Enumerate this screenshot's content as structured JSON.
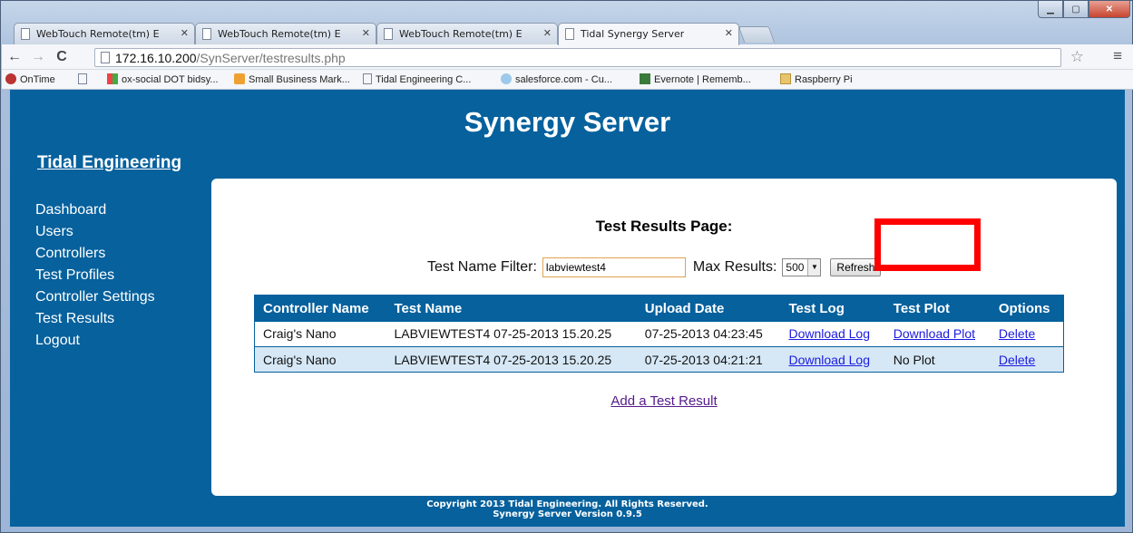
{
  "browser": {
    "tabs": [
      {
        "title": "WebTouch Remote(tm) E"
      },
      {
        "title": "WebTouch Remote(tm) E"
      },
      {
        "title": "WebTouch Remote(tm) E"
      },
      {
        "title": "Tidal Synergy Server"
      }
    ],
    "url_host": "172.16.10.200",
    "url_path": "/SynServer/testresults.php",
    "bookmarks": [
      "OnTime",
      "",
      "ox-social DOT bidsy...",
      "Small Business Mark...",
      "Tidal Engineering C...",
      "salesforce.com - Cu...",
      "Evernote | Rememb...",
      "Raspberry Pi"
    ]
  },
  "site": {
    "title": "Synergy Server",
    "brand": "Tidal Engineering",
    "nav": [
      "Dashboard",
      "Users",
      "Controllers",
      "Test Profiles",
      "Controller Settings",
      "Test Results",
      "Logout"
    ]
  },
  "main": {
    "heading": "Test Results Page:",
    "filter_label": "Test Name Filter:",
    "filter_value": "labviewtest4",
    "max_label": "Max Results:",
    "max_value": "500",
    "refresh_label": "Refresh",
    "columns": [
      "Controller Name",
      "Test Name",
      "Upload Date",
      "Test Log",
      "Test Plot",
      "Options"
    ],
    "rows": [
      {
        "controller": "Craig's Nano",
        "test": "LABVIEWTEST4 07-25-2013 15.20.25",
        "date": "07-25-2013 04:23:45",
        "log": "Download Log",
        "plot": "Download Plot",
        "option": "Delete"
      },
      {
        "controller": "Craig's Nano",
        "test": "LABVIEWTEST4 07-25-2013 15.20.25",
        "date": "07-25-2013 04:21:21",
        "log": "Download Log",
        "plot": "No Plot",
        "option": "Delete"
      }
    ],
    "add_link": "Add a Test Result"
  },
  "footer": {
    "line1": "Copyright 2013 Tidal Engineering. All Rights Reserved.",
    "line2": "Synergy Server Version 0.9.5"
  },
  "colors": {
    "page_bg": "#06619d",
    "highlight": "#ff0000"
  }
}
